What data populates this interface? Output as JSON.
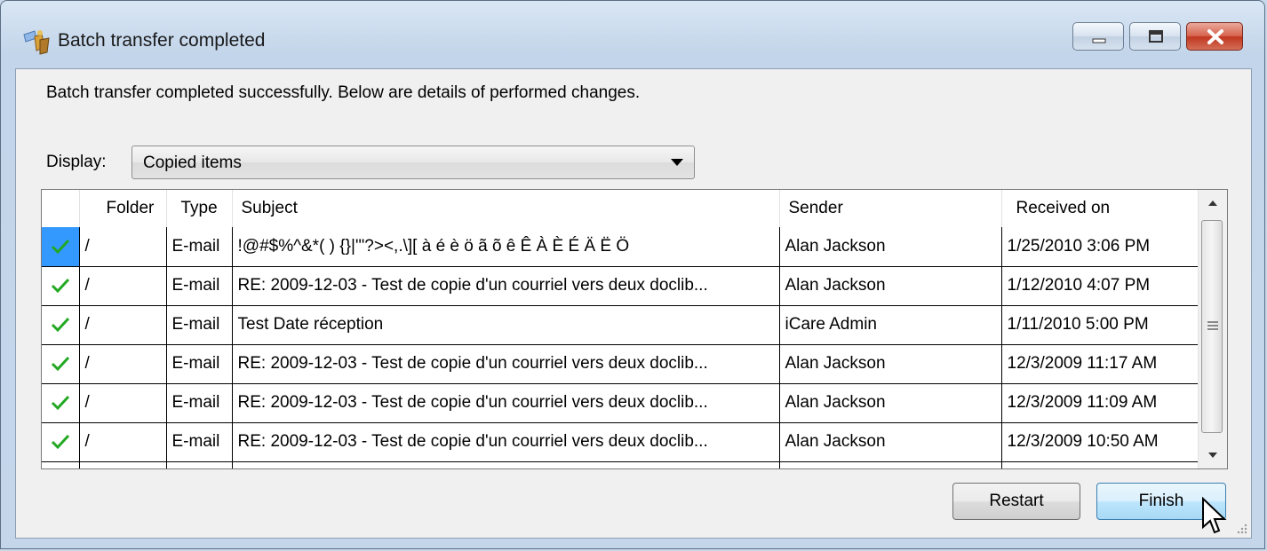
{
  "window": {
    "title": "Batch transfer completed",
    "icon": "transfer-app-icon"
  },
  "intro_text": "Batch transfer completed successfully. Below are details of performed changes.",
  "display": {
    "label": "Display:",
    "selected": "Copied items"
  },
  "table": {
    "columns": [
      "",
      "Folder",
      "Type",
      "Subject",
      "Sender",
      "Received on"
    ],
    "rows": [
      {
        "folder": "/",
        "type": "E-mail",
        "subject": "!@#$%^&*( ) {}|'\"?><,.\\][ à é è ö ã õ ê Ê À È É Ä Ë Ö",
        "sender": "Alan Jackson",
        "received": "1/25/2010 3:06 PM"
      },
      {
        "folder": "/",
        "type": "E-mail",
        "subject": "RE: 2009-12-03 - Test de copie d'un courriel vers deux doclib...",
        "sender": "Alan Jackson",
        "received": "1/12/2010 4:07 PM"
      },
      {
        "folder": "/",
        "type": "E-mail",
        "subject": "Test Date réception",
        "sender": "iCare Admin",
        "received": "1/11/2010 5:00 PM"
      },
      {
        "folder": "/",
        "type": "E-mail",
        "subject": "RE: 2009-12-03 - Test de copie d'un courriel vers deux doclib...",
        "sender": "Alan Jackson",
        "received": "12/3/2009 11:17 AM"
      },
      {
        "folder": "/",
        "type": "E-mail",
        "subject": "RE: 2009-12-03 - Test de copie d'un courriel vers deux doclib...",
        "sender": "Alan Jackson",
        "received": "12/3/2009 11:09 AM"
      },
      {
        "folder": "/",
        "type": "E-mail",
        "subject": "RE: 2009-12-03 - Test de copie d'un courriel vers deux doclib...",
        "sender": "Alan Jackson",
        "received": "12/3/2009 10:50 AM"
      }
    ]
  },
  "buttons": {
    "restart": "Restart",
    "finish": "Finish"
  },
  "colors": {
    "check": "#22a822",
    "selection": "#3399ff"
  }
}
